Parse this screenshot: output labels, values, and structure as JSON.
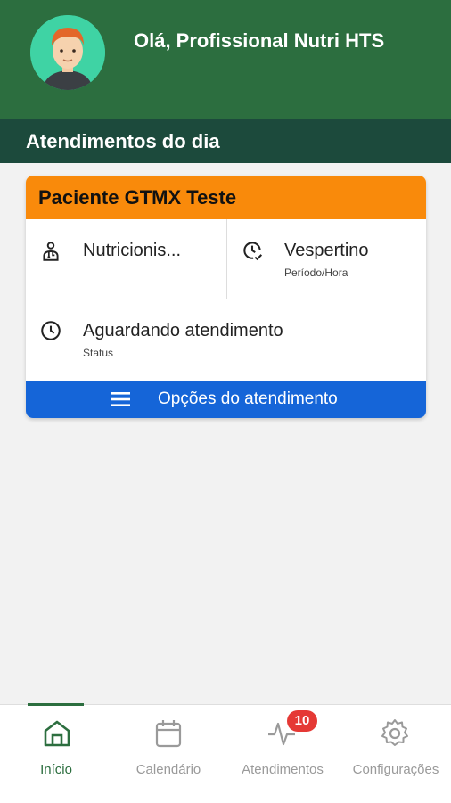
{
  "header": {
    "greeting": "Olá, Profissional Nutri HTS",
    "avatar_icon": "avatar-icon",
    "bg_color": "#2c6e3f"
  },
  "section": {
    "title": "Atendimentos do dia",
    "bg_color": "#1c4a3c"
  },
  "card": {
    "patient_name": "Paciente GTMX Teste",
    "header_color": "#f98a0b",
    "professional": {
      "icon": "doctor-icon",
      "value": "Nutricionis..."
    },
    "period": {
      "icon": "clock-check-icon",
      "value": "Vespertino",
      "label": "Período/Hora"
    },
    "status": {
      "icon": "clock-icon",
      "value": "Aguardando atendimento",
      "label": "Status"
    },
    "options": {
      "icon": "menu-icon",
      "label": "Opções do atendimento",
      "color": "#1565d8"
    }
  },
  "bottom_nav": {
    "items": [
      {
        "label": "Início",
        "icon": "home-icon",
        "active": true
      },
      {
        "label": "Calendário",
        "icon": "calendar-icon",
        "active": false
      },
      {
        "label": "Atendimentos",
        "icon": "activity-icon",
        "active": false,
        "badge": "10"
      },
      {
        "label": "Configurações",
        "icon": "gear-icon",
        "active": false
      }
    ],
    "active_color": "#2c6e3f",
    "inactive_color": "#9a9a9a"
  }
}
